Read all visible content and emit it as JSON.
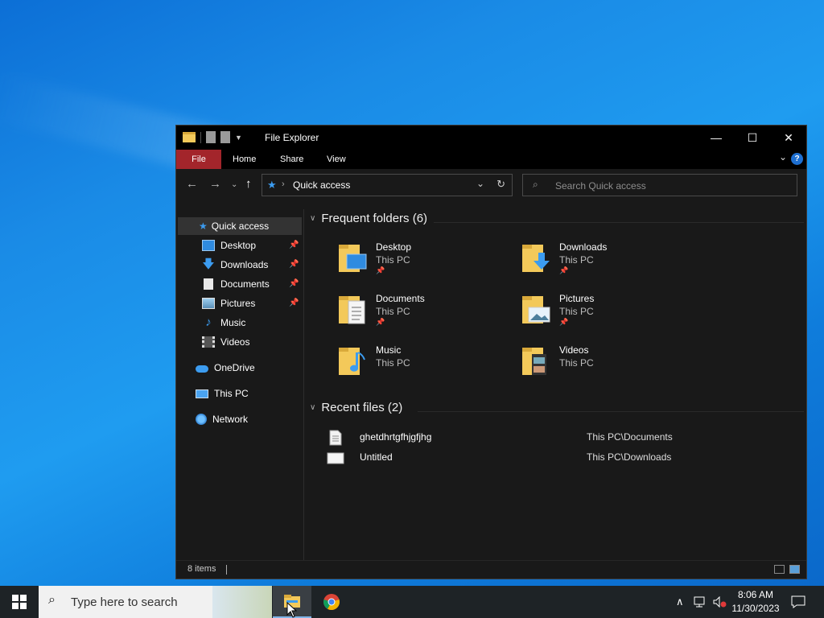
{
  "window": {
    "title": "File Explorer",
    "controls": {
      "minimize": "—",
      "maximize": "☐",
      "close": "✕"
    }
  },
  "ribbon": {
    "tabs": [
      "File",
      "Home",
      "Share",
      "View"
    ],
    "help": "?"
  },
  "address": {
    "location": "Quick access"
  },
  "search": {
    "placeholder": "Search Quick access"
  },
  "nav_pane": {
    "quick_access": "Quick access",
    "pinned": [
      "Desktop",
      "Downloads",
      "Documents",
      "Pictures"
    ],
    "unpinned": [
      "Music",
      "Videos"
    ],
    "onedrive": "OneDrive",
    "this_pc": "This PC",
    "network": "Network"
  },
  "frequent": {
    "header": "Frequent folders (6)",
    "folders": [
      {
        "name": "Desktop",
        "location": "This PC",
        "pinned": true
      },
      {
        "name": "Downloads",
        "location": "This PC",
        "pinned": true
      },
      {
        "name": "Documents",
        "location": "This PC",
        "pinned": true
      },
      {
        "name": "Pictures",
        "location": "This PC",
        "pinned": true
      },
      {
        "name": "Music",
        "location": "This PC",
        "pinned": false
      },
      {
        "name": "Videos",
        "location": "This PC",
        "pinned": false
      }
    ]
  },
  "recent": {
    "header": "Recent files (2)",
    "files": [
      {
        "name": "ghetdhrtgfhjgfjhg",
        "path": "This PC\\Documents"
      },
      {
        "name": "Untitled",
        "path": "This PC\\Downloads"
      }
    ]
  },
  "status": {
    "count": "8 items"
  },
  "taskbar": {
    "search_placeholder": "Type here to search",
    "time": "8:06 AM",
    "date": "11/30/2023"
  },
  "colors": {
    "file_tab": "#a3252b",
    "accent": "#3c9cf0",
    "folder": "#f3c95a",
    "window_bg": "#191919"
  }
}
